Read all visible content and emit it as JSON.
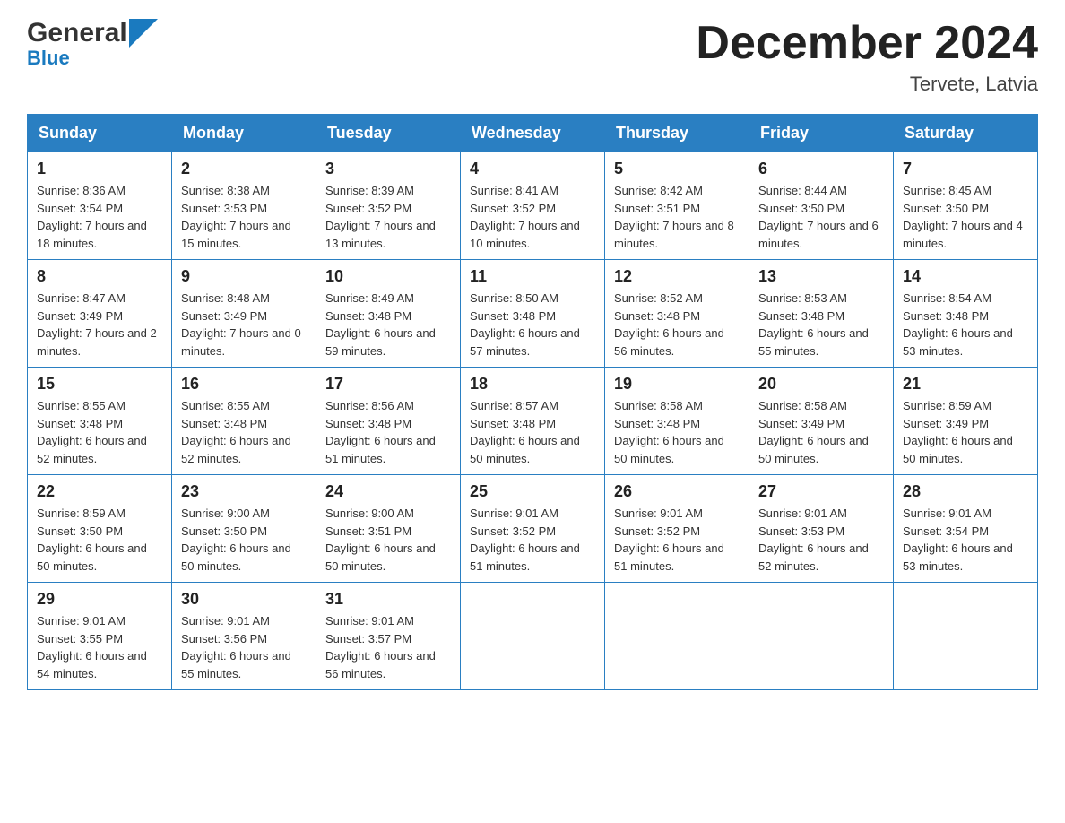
{
  "header": {
    "logo_text_general": "General",
    "logo_text_blue": "Blue",
    "title": "December 2024",
    "location": "Tervete, Latvia"
  },
  "days_of_week": [
    "Sunday",
    "Monday",
    "Tuesday",
    "Wednesday",
    "Thursday",
    "Friday",
    "Saturday"
  ],
  "weeks": [
    [
      {
        "day": "1",
        "sunrise": "Sunrise: 8:36 AM",
        "sunset": "Sunset: 3:54 PM",
        "daylight": "Daylight: 7 hours and 18 minutes."
      },
      {
        "day": "2",
        "sunrise": "Sunrise: 8:38 AM",
        "sunset": "Sunset: 3:53 PM",
        "daylight": "Daylight: 7 hours and 15 minutes."
      },
      {
        "day": "3",
        "sunrise": "Sunrise: 8:39 AM",
        "sunset": "Sunset: 3:52 PM",
        "daylight": "Daylight: 7 hours and 13 minutes."
      },
      {
        "day": "4",
        "sunrise": "Sunrise: 8:41 AM",
        "sunset": "Sunset: 3:52 PM",
        "daylight": "Daylight: 7 hours and 10 minutes."
      },
      {
        "day": "5",
        "sunrise": "Sunrise: 8:42 AM",
        "sunset": "Sunset: 3:51 PM",
        "daylight": "Daylight: 7 hours and 8 minutes."
      },
      {
        "day": "6",
        "sunrise": "Sunrise: 8:44 AM",
        "sunset": "Sunset: 3:50 PM",
        "daylight": "Daylight: 7 hours and 6 minutes."
      },
      {
        "day": "7",
        "sunrise": "Sunrise: 8:45 AM",
        "sunset": "Sunset: 3:50 PM",
        "daylight": "Daylight: 7 hours and 4 minutes."
      }
    ],
    [
      {
        "day": "8",
        "sunrise": "Sunrise: 8:47 AM",
        "sunset": "Sunset: 3:49 PM",
        "daylight": "Daylight: 7 hours and 2 minutes."
      },
      {
        "day": "9",
        "sunrise": "Sunrise: 8:48 AM",
        "sunset": "Sunset: 3:49 PM",
        "daylight": "Daylight: 7 hours and 0 minutes."
      },
      {
        "day": "10",
        "sunrise": "Sunrise: 8:49 AM",
        "sunset": "Sunset: 3:48 PM",
        "daylight": "Daylight: 6 hours and 59 minutes."
      },
      {
        "day": "11",
        "sunrise": "Sunrise: 8:50 AM",
        "sunset": "Sunset: 3:48 PM",
        "daylight": "Daylight: 6 hours and 57 minutes."
      },
      {
        "day": "12",
        "sunrise": "Sunrise: 8:52 AM",
        "sunset": "Sunset: 3:48 PM",
        "daylight": "Daylight: 6 hours and 56 minutes."
      },
      {
        "day": "13",
        "sunrise": "Sunrise: 8:53 AM",
        "sunset": "Sunset: 3:48 PM",
        "daylight": "Daylight: 6 hours and 55 minutes."
      },
      {
        "day": "14",
        "sunrise": "Sunrise: 8:54 AM",
        "sunset": "Sunset: 3:48 PM",
        "daylight": "Daylight: 6 hours and 53 minutes."
      }
    ],
    [
      {
        "day": "15",
        "sunrise": "Sunrise: 8:55 AM",
        "sunset": "Sunset: 3:48 PM",
        "daylight": "Daylight: 6 hours and 52 minutes."
      },
      {
        "day": "16",
        "sunrise": "Sunrise: 8:55 AM",
        "sunset": "Sunset: 3:48 PM",
        "daylight": "Daylight: 6 hours and 52 minutes."
      },
      {
        "day": "17",
        "sunrise": "Sunrise: 8:56 AM",
        "sunset": "Sunset: 3:48 PM",
        "daylight": "Daylight: 6 hours and 51 minutes."
      },
      {
        "day": "18",
        "sunrise": "Sunrise: 8:57 AM",
        "sunset": "Sunset: 3:48 PM",
        "daylight": "Daylight: 6 hours and 50 minutes."
      },
      {
        "day": "19",
        "sunrise": "Sunrise: 8:58 AM",
        "sunset": "Sunset: 3:48 PM",
        "daylight": "Daylight: 6 hours and 50 minutes."
      },
      {
        "day": "20",
        "sunrise": "Sunrise: 8:58 AM",
        "sunset": "Sunset: 3:49 PM",
        "daylight": "Daylight: 6 hours and 50 minutes."
      },
      {
        "day": "21",
        "sunrise": "Sunrise: 8:59 AM",
        "sunset": "Sunset: 3:49 PM",
        "daylight": "Daylight: 6 hours and 50 minutes."
      }
    ],
    [
      {
        "day": "22",
        "sunrise": "Sunrise: 8:59 AM",
        "sunset": "Sunset: 3:50 PM",
        "daylight": "Daylight: 6 hours and 50 minutes."
      },
      {
        "day": "23",
        "sunrise": "Sunrise: 9:00 AM",
        "sunset": "Sunset: 3:50 PM",
        "daylight": "Daylight: 6 hours and 50 minutes."
      },
      {
        "day": "24",
        "sunrise": "Sunrise: 9:00 AM",
        "sunset": "Sunset: 3:51 PM",
        "daylight": "Daylight: 6 hours and 50 minutes."
      },
      {
        "day": "25",
        "sunrise": "Sunrise: 9:01 AM",
        "sunset": "Sunset: 3:52 PM",
        "daylight": "Daylight: 6 hours and 51 minutes."
      },
      {
        "day": "26",
        "sunrise": "Sunrise: 9:01 AM",
        "sunset": "Sunset: 3:52 PM",
        "daylight": "Daylight: 6 hours and 51 minutes."
      },
      {
        "day": "27",
        "sunrise": "Sunrise: 9:01 AM",
        "sunset": "Sunset: 3:53 PM",
        "daylight": "Daylight: 6 hours and 52 minutes."
      },
      {
        "day": "28",
        "sunrise": "Sunrise: 9:01 AM",
        "sunset": "Sunset: 3:54 PM",
        "daylight": "Daylight: 6 hours and 53 minutes."
      }
    ],
    [
      {
        "day": "29",
        "sunrise": "Sunrise: 9:01 AM",
        "sunset": "Sunset: 3:55 PM",
        "daylight": "Daylight: 6 hours and 54 minutes."
      },
      {
        "day": "30",
        "sunrise": "Sunrise: 9:01 AM",
        "sunset": "Sunset: 3:56 PM",
        "daylight": "Daylight: 6 hours and 55 minutes."
      },
      {
        "day": "31",
        "sunrise": "Sunrise: 9:01 AM",
        "sunset": "Sunset: 3:57 PM",
        "daylight": "Daylight: 6 hours and 56 minutes."
      },
      null,
      null,
      null,
      null
    ]
  ]
}
